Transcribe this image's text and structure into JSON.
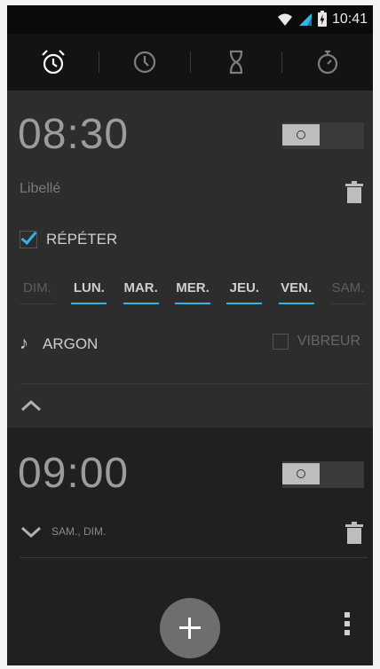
{
  "status_bar": {
    "time": "10:41",
    "icons": [
      "wifi-icon",
      "signal-icon",
      "battery-icon"
    ]
  },
  "tabs": [
    {
      "name": "alarm-tab",
      "icon": "alarm-clock-icon",
      "active": true
    },
    {
      "name": "clock-tab",
      "icon": "clock-icon",
      "active": false
    },
    {
      "name": "timer-tab",
      "icon": "hourglass-icon",
      "active": false
    },
    {
      "name": "stopwatch-tab",
      "icon": "stopwatch-icon",
      "active": false
    }
  ],
  "alarm1": {
    "time": "08:30",
    "label_placeholder": "Libellé",
    "repeat_label": "RÉPÉTER",
    "days": [
      {
        "label": "DIM.",
        "on": false
      },
      {
        "label": "LUN.",
        "on": true
      },
      {
        "label": "MAR.",
        "on": true
      },
      {
        "label": "MER.",
        "on": true
      },
      {
        "label": "JEU.",
        "on": true
      },
      {
        "label": "VEN.",
        "on": true
      },
      {
        "label": "SAM.",
        "on": false
      }
    ],
    "ringtone": "ARGON",
    "vibrate_label": "VIBREUR"
  },
  "alarm2": {
    "time": "09:00",
    "days_summary": "SAM., DIM."
  },
  "colors": {
    "accent": "#33b5e5"
  }
}
